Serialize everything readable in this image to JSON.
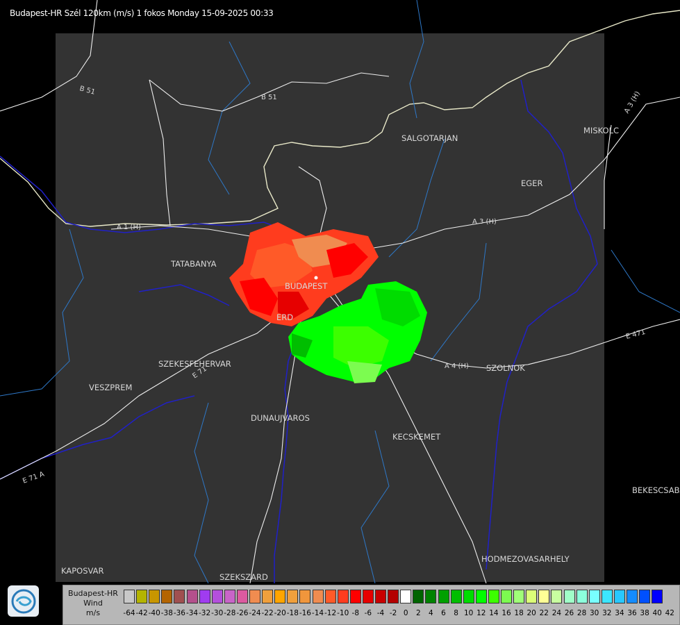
{
  "header": {
    "title": "Budapest-HR Szél 120km (m/s) 1 fokos Monday 15-09-2025 00:33"
  },
  "cities": [
    {
      "id": "salgotarjan",
      "name": "SALGOTARJAN"
    },
    {
      "id": "miskolc",
      "name": "MISKOLC"
    },
    {
      "id": "eger",
      "name": "EGER"
    },
    {
      "id": "tatabanya",
      "name": "TATABANYA"
    },
    {
      "id": "budapest",
      "name": "BUDAPEST"
    },
    {
      "id": "erd",
      "name": "ERD"
    },
    {
      "id": "szekesfehervar",
      "name": "SZEKESFEHERVAR"
    },
    {
      "id": "veszprem",
      "name": "VESZPREM"
    },
    {
      "id": "dunaujvaros",
      "name": "DUNAUJVAROS"
    },
    {
      "id": "kecskemet",
      "name": "KECSKEMET"
    },
    {
      "id": "szolnok",
      "name": "SZOLNOK"
    },
    {
      "id": "bekescsaba",
      "name": "BEKESCSABA"
    },
    {
      "id": "hodmezovasarhely",
      "name": "HODMEZOVASARHELY"
    },
    {
      "id": "kaposvar",
      "name": "KAPOSVAR"
    },
    {
      "id": "szekszard",
      "name": "SZEKSZARD"
    }
  ],
  "roads": [
    {
      "id": "b51-west",
      "label": "B 51"
    },
    {
      "id": "b51",
      "label": "B 51"
    },
    {
      "id": "a1",
      "label": "A 1 (H)"
    },
    {
      "id": "a3",
      "label": "A 3 (H)"
    },
    {
      "id": "a3-ne",
      "label": "A 3 (H)"
    },
    {
      "id": "a4",
      "label": "A 4 (H)"
    },
    {
      "id": "e471",
      "label": "E 471"
    },
    {
      "id": "e71",
      "label": "E 71"
    },
    {
      "id": "e71-sw",
      "label": "E 71 A"
    }
  ],
  "legend": {
    "line1": "Budapest-HR",
    "line2": "Wind",
    "line3": "m/s",
    "labels": [
      "-64",
      "-42",
      "-40",
      "-38",
      "-36",
      "-34",
      "-32",
      "-30",
      "-28",
      "-26",
      "-24",
      "-22",
      "-20",
      "-18",
      "-16",
      "-14",
      "-12",
      "-10",
      "-8",
      "-6",
      "-4",
      "-2",
      "0",
      "2",
      "4",
      "6",
      "8",
      "10",
      "12",
      "14",
      "16",
      "18",
      "20",
      "22",
      "24",
      "26",
      "28",
      "30",
      "32",
      "34",
      "36",
      "38",
      "40",
      "42"
    ],
    "colors": [
      "#c8c8c8",
      "#b4b400",
      "#c89600",
      "#b46400",
      "#a05050",
      "#b4508c",
      "#a03cf0",
      "#b450dc",
      "#c864c8",
      "#dc5aa0",
      "#f08c50",
      "#f0a03c",
      "#ffa500",
      "#f0a03c",
      "#f0963c",
      "#f08c50",
      "#ff5a28",
      "#ff3c1e",
      "#ff0000",
      "#e60000",
      "#c80000",
      "#b40000",
      "#ffffff",
      "#006400",
      "#008200",
      "#00a000",
      "#00be00",
      "#00dc00",
      "#00ff00",
      "#3cff00",
      "#7cfc50",
      "#a0ff78",
      "#dcff78",
      "#ffff96",
      "#c8ffa0",
      "#a0ffc8",
      "#8cffdc",
      "#78ffff",
      "#3ce6ff",
      "#28c8ff",
      "#148cff",
      "#0050ff",
      "#0000ff"
    ]
  },
  "logo": {
    "icon": "weather-service-logo-icon"
  }
}
